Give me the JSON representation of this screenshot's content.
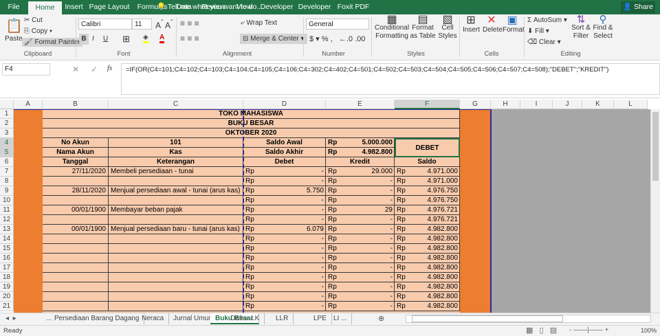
{
  "ribbon_tabs": [
    "File",
    "Home",
    "Insert",
    "Page Layout",
    "Formulas",
    "Data",
    "Review",
    "View",
    "Developer",
    "Developer",
    "Foxit PDF"
  ],
  "tell_me": "Tell me what you want to do...",
  "share": "Share",
  "clipboard": {
    "paste": "Paste",
    "cut": "Cut",
    "copy": "Copy",
    "format_painter": "Format Painter",
    "group": "Clipboard"
  },
  "font": {
    "name": "Calibri",
    "size": "11",
    "bold": "B",
    "italic": "I",
    "underline": "U",
    "group": "Font"
  },
  "alignment": {
    "wrap": "Wrap Text",
    "merge": "Merge & Center",
    "group": "Alignment"
  },
  "number": {
    "format": "General",
    "percent": "%",
    "comma": ",",
    "group": "Number"
  },
  "styles": {
    "conditional": "Conditional Formatting",
    "format_table": "Format as Table",
    "cell_styles": "Cell Styles",
    "group": "Styles"
  },
  "cells": {
    "insert": "Insert",
    "delete": "Delete",
    "format": "Format",
    "group": "Cells"
  },
  "editing": {
    "autosum": "AutoSum",
    "fill": "Fill",
    "clear": "Clear",
    "sort": "Sort & Filter",
    "find": "Find & Select",
    "group": "Editing"
  },
  "name_box": "F4",
  "formula": "=IF(OR(C4=101;C4=102;C4=103;C4=104;C4=105;C4=106;C4=302;C4=402;C4=501;C4=502;C4=503;C4=504;C4=505;C4=506;C4=507;C4=508);\"DEBET\";\"KREDIT\")",
  "columns": [
    "A",
    "B",
    "C",
    "D",
    "E",
    "F",
    "G",
    "H",
    "I",
    "J",
    "K",
    "L"
  ],
  "sheet": {
    "title1": "TOKO MAHASISWA",
    "title2": "BUKU BESAR",
    "title3": "OKTOBER 2020",
    "no_akun_label": "No Akun",
    "no_akun": "101",
    "saldo_awal_label": "Saldo Awal",
    "rp": "Rp",
    "saldo_awal": "5.000.000",
    "nama_akun_label": "Nama Akun",
    "nama_akun": "Kas",
    "saldo_akhir_label": "Saldo Akhir",
    "saldo_akhir": "4.982.800",
    "type": "DEBET",
    "headers": [
      "Tanggal",
      "Keterangan",
      "Debet",
      "Kredit",
      "Saldo"
    ],
    "rows": [
      {
        "date": "27/11/2020",
        "desc": "Membeli persediaan - tunai",
        "debet": "-",
        "kredit": "29.000",
        "saldo": "4.971.000"
      },
      {
        "date": "",
        "desc": "",
        "debet": "-",
        "kredit": "-",
        "saldo": "4.971.000"
      },
      {
        "date": "28/11/2020",
        "desc": "Menjual persediaan awal - tunai (arus kas)",
        "debet": "5.750",
        "kredit": "-",
        "saldo": "4.976.750"
      },
      {
        "date": "",
        "desc": "",
        "debet": "-",
        "kredit": "-",
        "saldo": "4.976.750"
      },
      {
        "date": "00/01/1900",
        "desc": "Membayar beban pajak",
        "debet": "-",
        "kredit": "29",
        "saldo": "4.976.721"
      },
      {
        "date": "",
        "desc": "",
        "debet": "-",
        "kredit": "-",
        "saldo": "4.976.721"
      },
      {
        "date": "00/01/1900",
        "desc": "Menjual persediaan baru - tunai (arus kas)",
        "debet": "6.079",
        "kredit": "-",
        "saldo": "4.982.800"
      },
      {
        "date": "",
        "desc": "",
        "debet": "-",
        "kredit": "-",
        "saldo": "4.982.800"
      },
      {
        "date": "",
        "desc": "",
        "debet": "-",
        "kredit": "-",
        "saldo": "4.982.800"
      },
      {
        "date": "",
        "desc": "",
        "debet": "-",
        "kredit": "-",
        "saldo": "4.982.800"
      },
      {
        "date": "",
        "desc": "",
        "debet": "-",
        "kredit": "-",
        "saldo": "4.982.800"
      },
      {
        "date": "",
        "desc": "",
        "debet": "-",
        "kredit": "-",
        "saldo": "4.982.800"
      },
      {
        "date": "",
        "desc": "",
        "debet": "-",
        "kredit": "-",
        "saldo": "4.982.800"
      },
      {
        "date": "",
        "desc": "",
        "debet": "-",
        "kredit": "-",
        "saldo": "4.982.800"
      },
      {
        "date": "",
        "desc": "",
        "debet": "-",
        "kredit": "-",
        "saldo": "4.982.800"
      }
    ]
  },
  "sheet_tabs": [
    "...",
    "Persediaan Barang Dagang",
    "Neraca",
    "Jurnal Umum",
    "Buku Besar",
    "Daftar LK",
    "LLR",
    "LPE",
    "LI ..."
  ],
  "active_sheet": "Buku Besar",
  "status": "Ready",
  "zoom": "100%",
  "colors": {
    "green": "#217346",
    "cell": "#f8cbad",
    "orange": "#ed7d31",
    "grey": "#a6a6a6"
  }
}
